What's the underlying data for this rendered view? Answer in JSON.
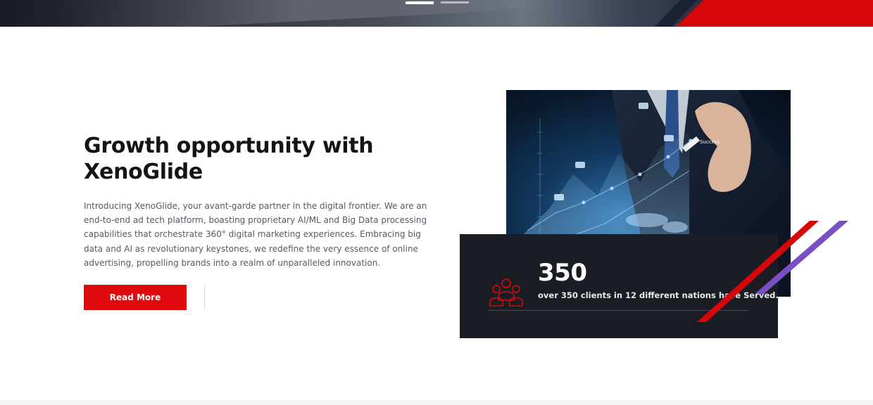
{
  "hero": {
    "slides": [
      {
        "label": "",
        "active": true
      },
      {
        "label": "",
        "active": false
      }
    ],
    "colors": {
      "accent": "#d7060b",
      "dark": "#1c2233"
    }
  },
  "about": {
    "heading": "Growth opportunity with XenoGlide",
    "body": "Introducing XenoGlide, your avant-garde partner in the digital frontier. We are an end-to-end ad tech platform, boasting proprietary AI/ML and Big Data processing capabilities that orchestrate 360° digital marketing experiences. Embracing big data and AI as revolutionary keystones, we redefine the very essence of online advertising, propelling brands into a realm of unparalleled innovation.",
    "cta_label": "Read More"
  },
  "feature_image": {
    "icon": "businessman-drawing-growth-chart-image",
    "overlay_text": "Success"
  },
  "stats": {
    "icon": "clients-group-icon",
    "number": "350",
    "caption": "over 350 clients in 12 different nations have Served."
  },
  "colors": {
    "primary_red": "#e10a0e",
    "heading": "#141414",
    "body_text": "#555a62",
    "card_bg": "#1b1d24",
    "stripe_red": "#d7060b",
    "stripe_purple": "#7a4fc4"
  }
}
